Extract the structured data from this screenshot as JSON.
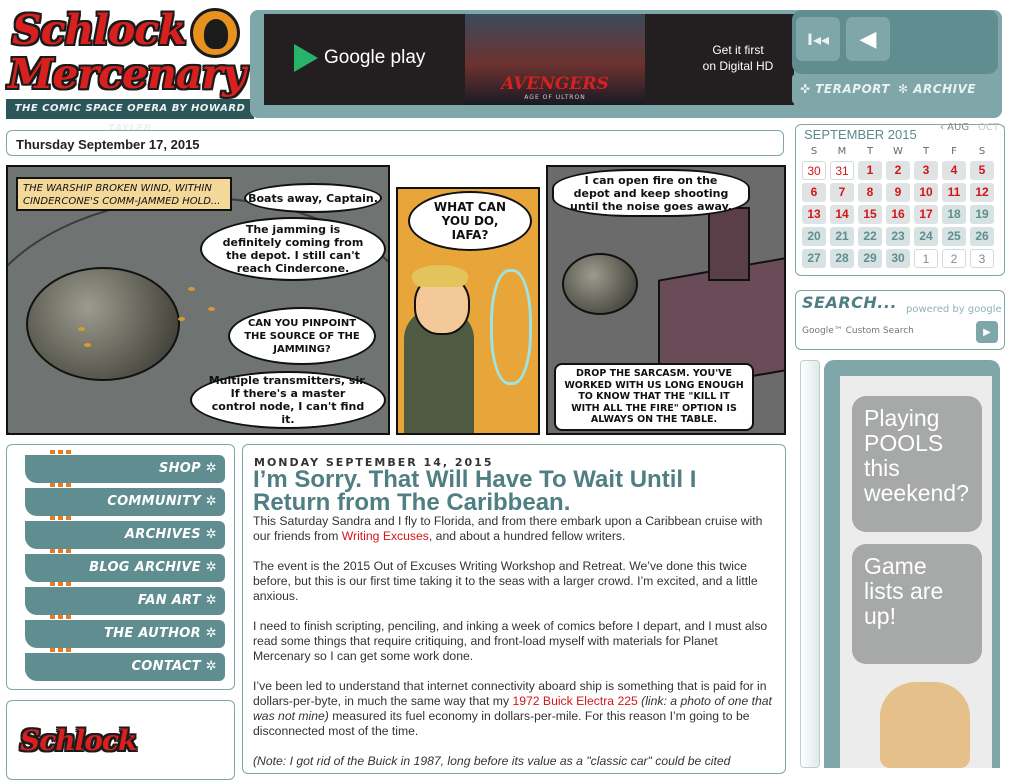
{
  "header": {
    "logo_line1": "Schlock",
    "logo_line2": "Mercenary",
    "tagline": "THE COMIC SPACE OPERA BY HOWARD TAYLER"
  },
  "ad_banner": {
    "store": "Google play",
    "film_title": "AVENGERS",
    "film_subtitle": "AGE OF ULTRON",
    "cta_line1": "Get it first",
    "cta_line2": "on Digital HD"
  },
  "comic_nav": {
    "first_icon": "first-strip-icon",
    "prev_icon": "previous-strip-icon",
    "teraport": "TERAPORT",
    "archive": "ARCHIVE"
  },
  "strip": {
    "date": "Thursday September 17, 2015",
    "panel1_caption": "THE WARSHIP BROKEN WIND, WITHIN CINDERCONE'S COMM-JAMMED HOLD...",
    "panel1_b1": "Boats away, Captain.",
    "panel1_b2": "The jamming is definitely coming from the depot. I still can't reach Cindercone.",
    "panel1_b3": "CAN YOU PINPOINT THE SOURCE OF THE JAMMING?",
    "panel1_b4": "Multiple transmitters, sir. If there's a master control node, I can't find it.",
    "panel2_b1": "WHAT CAN YOU DO, IAFA?",
    "panel3_b1": "I can open fire on the depot and keep shooting until the noise goes away.",
    "panel3_b2": "DROP THE SARCASM. YOU'VE WORKED WITH US LONG ENOUGH TO KNOW THAT THE \"KILL IT WITH ALL THE FIRE\" OPTION IS ALWAYS ON THE TABLE."
  },
  "calendar": {
    "title": "SEPTEMBER 2015",
    "prev": "‹ AUG",
    "next": "OCT ›",
    "weekdays": [
      "S",
      "M",
      "T",
      "W",
      "T",
      "F",
      "S"
    ],
    "days": [
      {
        "d": "30",
        "s": "outred"
      },
      {
        "d": "31",
        "s": "outred"
      },
      {
        "d": "1",
        "s": "red"
      },
      {
        "d": "2",
        "s": "red"
      },
      {
        "d": "3",
        "s": "red"
      },
      {
        "d": "4",
        "s": "red"
      },
      {
        "d": "5",
        "s": "red"
      },
      {
        "d": "6",
        "s": "red"
      },
      {
        "d": "7",
        "s": "red"
      },
      {
        "d": "8",
        "s": "red"
      },
      {
        "d": "9",
        "s": "red"
      },
      {
        "d": "10",
        "s": "red"
      },
      {
        "d": "11",
        "s": "red"
      },
      {
        "d": "12",
        "s": "red"
      },
      {
        "d": "13",
        "s": "red"
      },
      {
        "d": "14",
        "s": "red"
      },
      {
        "d": "15",
        "s": "red"
      },
      {
        "d": "16",
        "s": "red"
      },
      {
        "d": "17",
        "s": "red"
      },
      {
        "d": "18",
        "s": "teal"
      },
      {
        "d": "19",
        "s": "teal"
      },
      {
        "d": "20",
        "s": "teal"
      },
      {
        "d": "21",
        "s": "teal"
      },
      {
        "d": "22",
        "s": "teal"
      },
      {
        "d": "23",
        "s": "teal"
      },
      {
        "d": "24",
        "s": "teal"
      },
      {
        "d": "25",
        "s": "teal"
      },
      {
        "d": "26",
        "s": "teal"
      },
      {
        "d": "27",
        "s": "teal"
      },
      {
        "d": "28",
        "s": "teal"
      },
      {
        "d": "29",
        "s": "teal"
      },
      {
        "d": "30",
        "s": "teal"
      },
      {
        "d": "1",
        "s": "plain"
      },
      {
        "d": "2",
        "s": "plain"
      },
      {
        "d": "3",
        "s": "plain"
      }
    ]
  },
  "search": {
    "title": "SEARCH...",
    "powered_by": "powered by google",
    "placeholder": "Google™ Custom Search"
  },
  "tower_ad": {
    "bubble1": "Playing POOLS this weekend?",
    "bubble2": "Game lists are up!"
  },
  "left_nav": [
    "SHOP",
    "COMMUNITY",
    "ARCHIVES",
    "BLOG ARCHIVE",
    "FAN ART",
    "THE AUTHOR",
    "CONTACT"
  ],
  "post": {
    "date": "MONDAY SEPTEMBER 14, 2015",
    "title": "I’m Sorry. That Will Have To Wait Until I Return from The Caribbean.",
    "p1_a": "This Saturday Sandra and I fly to Florida, and from there embark upon a Caribbean cruise with our friends from ",
    "p1_link": "Writing Excuses",
    "p1_b": ", and about a hundred fellow writers.",
    "p2": "The event is the 2015 Out of Excuses Writing Workshop and Retreat. We’ve done this twice before, but this is our first time taking it to the seas with a larger crowd. I’m excited, and a little anxious.",
    "p3": "I need to finish scripting, penciling, and inking a week of comics before I depart, and I must also read some things that require critiquing, and front-load myself with materials for Planet Mercenary so I can get some work done.",
    "p4_a": "I’ve been led to understand that internet connectivity aboard ship is something that is paid for in dollars-per-byte, in much the same way that my ",
    "p4_link": "1972 Buick Electra 225",
    "p4_italic": " (link: a photo of one that was not mine)",
    "p4_b": " measured its fuel economy in dollars-per-mile. For this reason I’m going to be disconnected most of the time.",
    "p5": "(Note: I got rid of the Buick in 1987, long before its value as a \"classic car\" could be cited"
  },
  "colors": {
    "teal": "#5f8d90",
    "teal_light": "#7fa6a8",
    "red": "#d3151b",
    "orange": "#e7791e"
  }
}
